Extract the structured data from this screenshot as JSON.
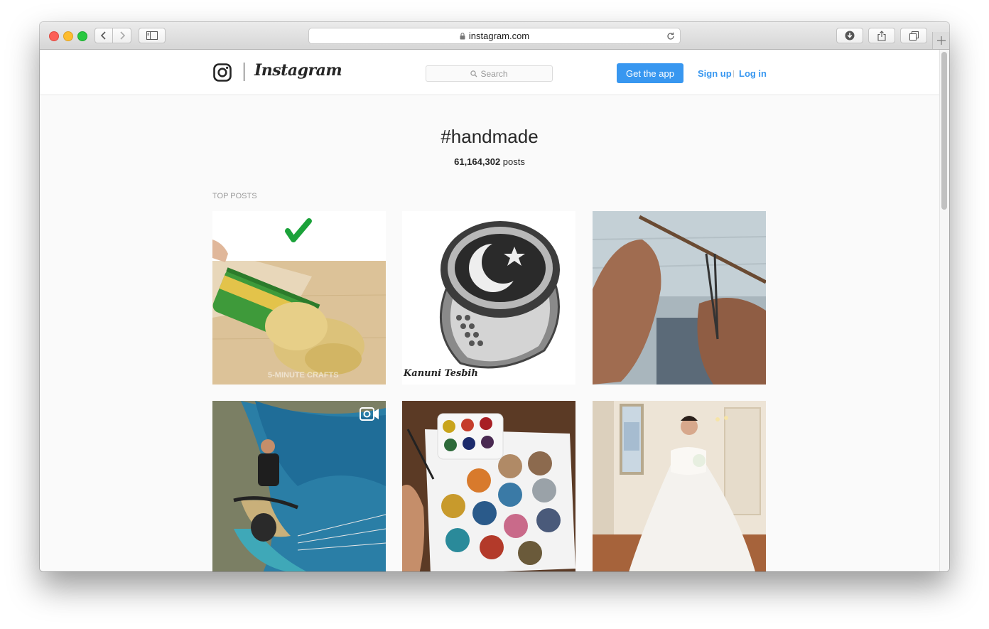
{
  "browser": {
    "url": "instagram.com"
  },
  "header": {
    "wordmark": "Instagram",
    "search_placeholder": "Search",
    "get_app_label": "Get the app",
    "signup_label": "Sign up",
    "login_label": "Log in"
  },
  "tag": {
    "name": "#handmade",
    "post_count": "61,164,302",
    "post_count_suffix": " posts"
  },
  "top_posts": {
    "label": "TOP POSTS",
    "posts": [
      {
        "kind": "video",
        "watermark": "5-MINUTE CRAFTS"
      },
      {
        "kind": "photo",
        "caption": "Kanuni Tesbih"
      },
      {
        "kind": "photo"
      },
      {
        "kind": "video"
      },
      {
        "kind": "photo"
      },
      {
        "kind": "photo"
      }
    ]
  },
  "colors": {
    "accent": "#3897f0",
    "text": "#262626",
    "muted": "#999999"
  }
}
